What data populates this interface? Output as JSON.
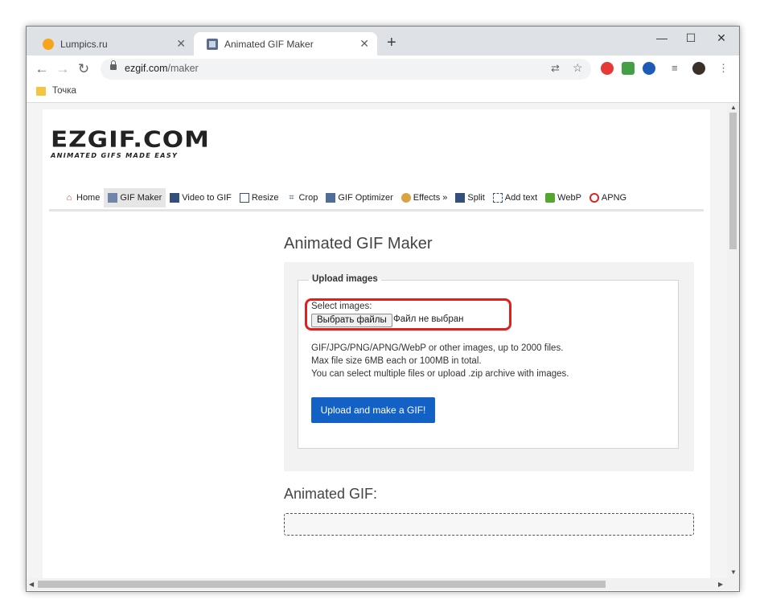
{
  "browser": {
    "tabs": [
      {
        "title": "Lumpics.ru",
        "active": false
      },
      {
        "title": "Animated GIF Maker",
        "active": true
      }
    ],
    "window_controls": {
      "minimize": "—",
      "maximize": "☐",
      "close": "✕"
    },
    "url_host": "ezgif.com",
    "url_path": "/maker",
    "bookmarks": [
      {
        "label": "Точка"
      }
    ]
  },
  "site": {
    "logo_main": "EZGIF.COM",
    "logo_sub": "ANIMATED GIFS MADE EASY",
    "nav": [
      {
        "label": "Home",
        "icon": "house-icon"
      },
      {
        "label": "GIF Maker",
        "icon": "gif-maker-icon",
        "active": true
      },
      {
        "label": "Video to GIF",
        "icon": "film-icon"
      },
      {
        "label": "Resize",
        "icon": "resize-icon"
      },
      {
        "label": "Crop",
        "icon": "crop-icon"
      },
      {
        "label": "GIF Optimizer",
        "icon": "optimizer-icon"
      },
      {
        "label": "Effects »",
        "icon": "palette-icon"
      },
      {
        "label": "Split",
        "icon": "split-icon"
      },
      {
        "label": "Add text",
        "icon": "add-text-icon"
      },
      {
        "label": "WebP",
        "icon": "webp-icon"
      },
      {
        "label": "APNG",
        "icon": "apng-icon"
      }
    ]
  },
  "main": {
    "title": "Animated GIF Maker",
    "upload_legend": "Upload images",
    "select_label": "Select images:",
    "file_button": "Выбрать файлы",
    "file_status": "Файл не выбран",
    "info_lines": [
      "GIF/JPG/PNG/APNG/WebP or other images, up to 2000 files.",
      "Max file size 6MB each or 100MB in total.",
      "You can select multiple files or upload .zip archive with images."
    ],
    "upload_button": "Upload and make a GIF!",
    "output_title": "Animated GIF:"
  },
  "colors": {
    "accent_button": "#1361c4",
    "highlight_ring": "#e0201e",
    "tab_strip": "#dee1e6"
  }
}
